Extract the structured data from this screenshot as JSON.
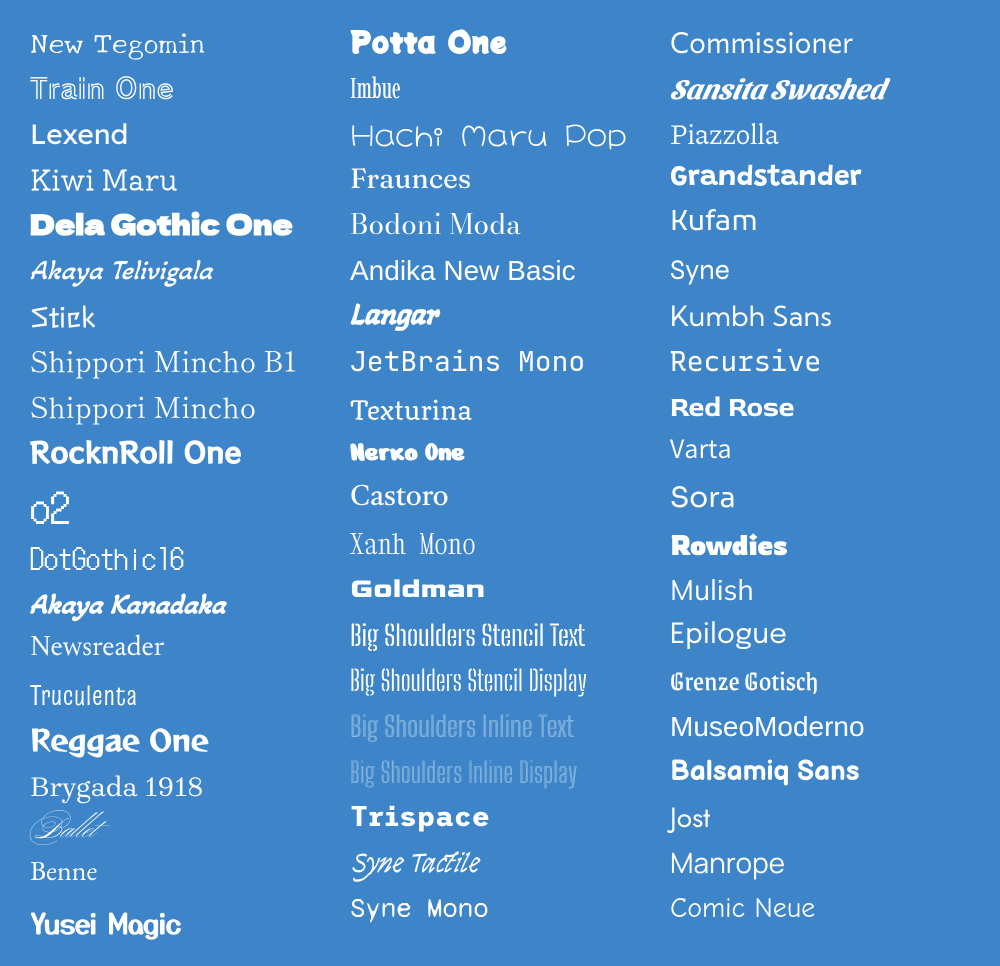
{
  "background": "#3d85c8",
  "columns": [
    {
      "id": "col1",
      "items": [
        {
          "label": "New Tegomin",
          "class": "f-new-tegomin",
          "faded": false
        },
        {
          "label": "Train One",
          "class": "f-train-one",
          "faded": false
        },
        {
          "label": "Lexend",
          "class": "f-lexend",
          "faded": false
        },
        {
          "label": "Kiwi Maru",
          "class": "f-kiwi-maru",
          "faded": false
        },
        {
          "label": "Dela Gothic One",
          "class": "f-dela-gothic-one",
          "faded": false
        },
        {
          "label": "Akaya Telivigala",
          "class": "f-akaya-telivigala",
          "faded": false
        },
        {
          "label": "Stick",
          "class": "f-stick",
          "faded": false
        },
        {
          "label": "Shippori Mincho B1",
          "class": "f-shippori-mincho-b1",
          "faded": false
        },
        {
          "label": "Shippori Mincho",
          "class": "f-shippori-mincho",
          "faded": false
        },
        {
          "label": "RocknRoll One",
          "class": "f-rocknroll-one",
          "faded": false
        },
        {
          "label": "o2",
          "class": "f-dotgothic16",
          "faded": false
        },
        {
          "label": "DotGothic16",
          "class": "f-dotgothic16-text",
          "faded": false
        },
        {
          "label": "Akaya Kanadaka",
          "class": "f-akaya-kanadaka",
          "faded": false
        },
        {
          "label": "Newsreader",
          "class": "f-newsreader",
          "faded": false
        },
        {
          "label": "Truculenta",
          "class": "f-truculenta",
          "faded": false
        },
        {
          "label": "Reggae One",
          "class": "f-reggae-one",
          "faded": false
        },
        {
          "label": "Brygada 1918",
          "class": "f-brygada-1918",
          "faded": false
        },
        {
          "label": "Ballet",
          "class": "f-ballet",
          "faded": false
        },
        {
          "label": "Benne",
          "class": "f-benne",
          "faded": false
        },
        {
          "label": "Yusei Magic",
          "class": "f-yusei-magic",
          "faded": false
        }
      ]
    },
    {
      "id": "col2",
      "items": [
        {
          "label": "Potta One",
          "class": "f-potta-one",
          "faded": false
        },
        {
          "label": "Imbue",
          "class": "f-imbue",
          "faded": false
        },
        {
          "label": "Hachi Maru Pop",
          "class": "f-hachi-maru-pop",
          "faded": false
        },
        {
          "label": "Fraunces",
          "class": "f-fraunces",
          "faded": false
        },
        {
          "label": "Bodoni Moda",
          "class": "f-bodoni-moda",
          "faded": false
        },
        {
          "label": "Andika New Basic",
          "class": "f-andika-new-basic",
          "faded": false
        },
        {
          "label": "Langar",
          "class": "f-langar",
          "faded": false
        },
        {
          "label": "JetBrains Mono",
          "class": "f-jetbrains-mono",
          "faded": false
        },
        {
          "label": "Texturina",
          "class": "f-texturina",
          "faded": false
        },
        {
          "label": "Nerko One",
          "class": "f-nerko-one",
          "faded": false
        },
        {
          "label": "Castoro",
          "class": "f-castoro",
          "faded": false
        },
        {
          "label": "Xanh Mono",
          "class": "f-xanh-mono",
          "faded": false
        },
        {
          "label": "Goldman",
          "class": "f-goldman",
          "faded": false
        },
        {
          "label": "Big Shoulders Stencil Text",
          "class": "f-big-shoulders-stencil-text",
          "faded": false
        },
        {
          "label": "Big Shoulders Stencil Display",
          "class": "f-big-shoulders-stencil-display",
          "faded": false
        },
        {
          "label": "Big Shoulders Inline Text",
          "class": "f-big-shoulders-inline-text",
          "faded": true
        },
        {
          "label": "Big Shoulders Inline Display",
          "class": "f-big-shoulders-inline-display",
          "faded": true
        },
        {
          "label": "Trispace",
          "class": "f-trispace",
          "faded": false
        },
        {
          "label": "Syne Tactile",
          "class": "f-syne-tactile",
          "faded": false
        },
        {
          "label": "Syne Mono",
          "class": "f-syne-mono",
          "faded": false
        }
      ]
    },
    {
      "id": "col3",
      "items": [
        {
          "label": "Commissioner",
          "class": "f-commissioner",
          "faded": false
        },
        {
          "label": "Sansita Swashed",
          "class": "f-sansita-swashed",
          "faded": false
        },
        {
          "label": "Piazzolla",
          "class": "f-piazzolla",
          "faded": false
        },
        {
          "label": "Grandstander",
          "class": "f-grandstander",
          "faded": false
        },
        {
          "label": "Kufam",
          "class": "f-kufam",
          "faded": false
        },
        {
          "label": "Syne",
          "class": "f-syne",
          "faded": false
        },
        {
          "label": "Kumbh Sans",
          "class": "f-kumbh-sans",
          "faded": false
        },
        {
          "label": "Recursive",
          "class": "f-recursive",
          "faded": false
        },
        {
          "label": "Red Rose",
          "class": "f-red-rose",
          "faded": false
        },
        {
          "label": "Varta",
          "class": "f-varta",
          "faded": false
        },
        {
          "label": "Sora",
          "class": "f-sora",
          "faded": false
        },
        {
          "label": "Rowdies",
          "class": "f-rowdies",
          "faded": false
        },
        {
          "label": "Mulish",
          "class": "f-mulish",
          "faded": false
        },
        {
          "label": "Epilogue",
          "class": "f-epilogue",
          "faded": false
        },
        {
          "label": "Grenze Gotisch",
          "class": "f-grenze-gotisch",
          "faded": false
        },
        {
          "label": "MuseoModerno",
          "class": "f-museo-moderno",
          "faded": false
        },
        {
          "label": "Balsamiq Sans",
          "class": "f-balsamiq-sans",
          "faded": false
        },
        {
          "label": "Jost",
          "class": "f-jost",
          "faded": false
        },
        {
          "label": "Manrope",
          "class": "f-manrope",
          "faded": false
        },
        {
          "label": "Comic Neue",
          "class": "f-comic-neue",
          "faded": false
        }
      ]
    }
  ]
}
